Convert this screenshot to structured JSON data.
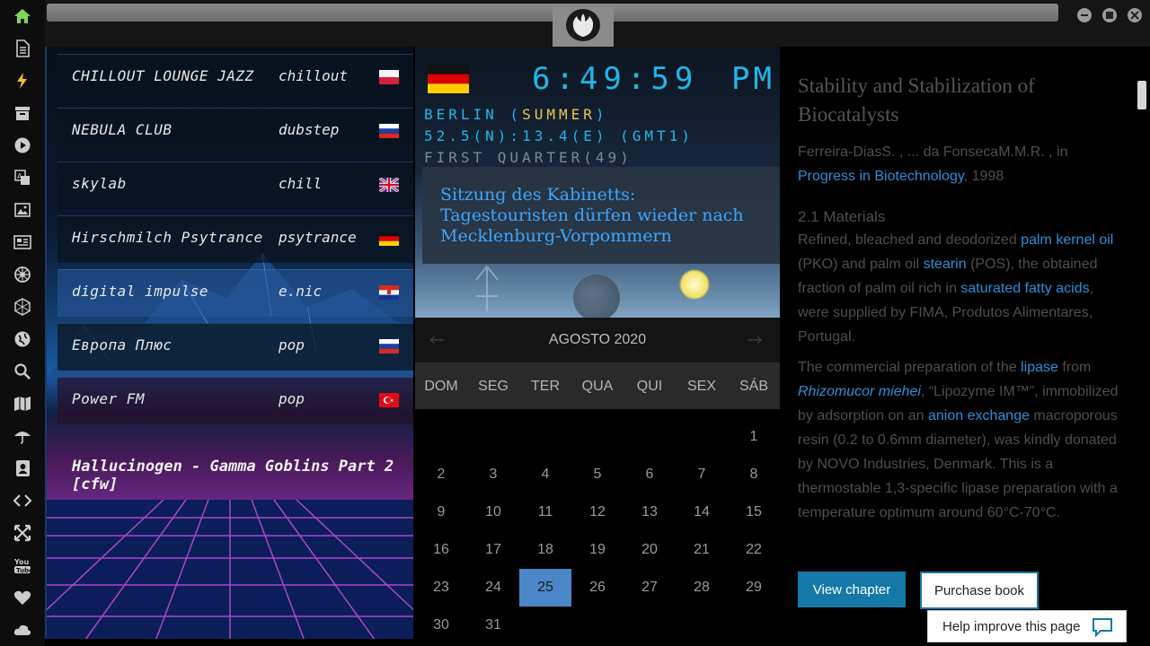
{
  "sidebar": {
    "icons": [
      "home-icon",
      "document-icon",
      "lightning-icon",
      "archive-icon",
      "play-circle-icon",
      "translate-icon",
      "image-icon",
      "newspaper-icon",
      "settings-wheel-icon",
      "hexagon-icon",
      "globe-icon",
      "search-icon",
      "map-icon",
      "umbrella-icon",
      "contact-icon",
      "code-icon",
      "expand-icon",
      "youtube-icon",
      "heart-icon",
      "cloud-icon"
    ],
    "active_color": "#7ed957"
  },
  "window": {
    "controls": [
      "minimize-icon",
      "maximize-icon",
      "close-icon"
    ]
  },
  "radio": {
    "stations": [
      {
        "name": "CHILLOUT LOUNGE JAZZ",
        "genre": "chillout",
        "flag": "poland-flag-icon"
      },
      {
        "name": "NEBULA CLUB",
        "genre": "dubstep",
        "flag": "russia-flag-icon"
      },
      {
        "name": "skylab",
        "genre": "chill",
        "flag": "uk-flag-icon"
      },
      {
        "name": "Hirschmilch Psytrance",
        "genre": "psytrance",
        "flag": "germany-flag-icon"
      },
      {
        "name": "digital impulse",
        "genre": "e.nic",
        "flag": "croatia-flag-icon"
      },
      {
        "name": "Европа Плюс",
        "genre": "pop",
        "flag": "russia-flag-icon"
      },
      {
        "name": "Power FM",
        "genre": "pop",
        "flag": "turkey-flag-icon"
      }
    ],
    "now_playing": "Hallucinogen - Gamma Goblins Part 2 [cfw]"
  },
  "clock": {
    "time": "6:49:59",
    "ampm": "PM",
    "city": "BERLIN",
    "season": "SUMMER",
    "coords": "52.5(N):13.4(E) (GMT1)",
    "moon": "FIRST QUARTER(49)",
    "flag": "germany-flag-icon",
    "news": "Sitzung des Kabinetts: Tagestouristen dürfen wieder nach Mecklenburg-Vorpommern"
  },
  "calendar": {
    "month": "AGOSTO 2020",
    "weekdays": [
      "DOM",
      "SEG",
      "TER",
      "QUA",
      "QUI",
      "SEX",
      "SÁB"
    ],
    "days": [
      "1",
      "2",
      "3",
      "4",
      "5",
      "6",
      "7",
      "8",
      "9",
      "10",
      "11",
      "12",
      "13",
      "14",
      "15",
      "16",
      "17",
      "18",
      "19",
      "20",
      "21",
      "22",
      "23",
      "24",
      "25",
      "26",
      "27",
      "28",
      "29",
      "30",
      "31"
    ],
    "selected": "25",
    "accent": "#4a86c8"
  },
  "article": {
    "title": "Stability and Stabilization of Biocatalysts",
    "authors": "Ferreira-DiasS. , ... da FonsecaM.M.R. , in",
    "source_link": "Progress in Biotechnology",
    "year": ", 1998",
    "section": "2.1 Materials",
    "p1": {
      "t1": "Refined, bleached and deodorized ",
      "l1": "palm kernel oil",
      "t2": " (PKO) and palm oil ",
      "l2": "stearin",
      "t3": " (POS), the obtained fraction of palm oil rich in ",
      "l3": "saturated fatty acids",
      "t4": ", were supplied by FIMA, Produtos Alimentares, Portugal."
    },
    "p2": {
      "t1": "The commercial preparation of the ",
      "l1": "lipase",
      "t2": " from ",
      "l2": "Rhizomucor miehei",
      "t3": ", “Lipozyme IM™”, immobilized by adsorption on an ",
      "l3": "anion exchange",
      "t4": " macroporous resin (0.2 to 0.6mm diameter), was kindly donated by NOVO Industries, Denmark. This is a thermostable 1,3-specific lipase preparation with a temperature optimum around 60°C-70°C."
    },
    "btn_view": "View chapter",
    "btn_buy": "Purchase book",
    "help": "Help improve this page",
    "link_color": "#2d8fd8",
    "button_color": "#1478a8"
  }
}
